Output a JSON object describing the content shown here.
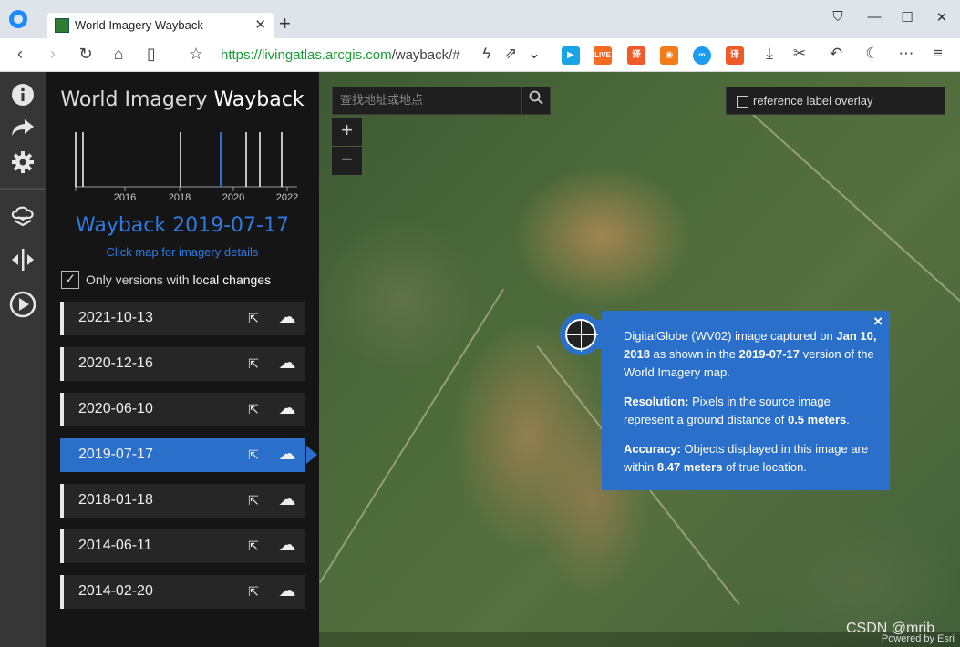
{
  "browser": {
    "tab_title": "World Imagery Wayback",
    "new_tab_symbol": "+",
    "url_host": "https://livingatlas.arcgis.com",
    "url_path": "/wayback/#",
    "window_buttons": [
      "minimize",
      "maximize",
      "close"
    ]
  },
  "app": {
    "title_light": "World Imagery",
    "title_bold": "Wayback",
    "timeline_years": [
      "2016",
      "2018",
      "2020",
      "2022"
    ],
    "selected_release": "Wayback 2019-07-17",
    "click_hint": "Click map for imagery details",
    "filter_label_prefix": "Only versions with",
    "filter_label_bold": "local changes",
    "filter_checked": true,
    "releases": [
      {
        "date": "2021-10-13",
        "active": false
      },
      {
        "date": "2020-12-16",
        "active": false
      },
      {
        "date": "2020-06-10",
        "active": false
      },
      {
        "date": "2019-07-17",
        "active": true
      },
      {
        "date": "2018-01-18",
        "active": false
      },
      {
        "date": "2014-06-11",
        "active": false
      },
      {
        "date": "2014-02-20",
        "active": false
      }
    ]
  },
  "map": {
    "search_placeholder": "查找地址或地点",
    "zoom_in": "+",
    "zoom_out": "−",
    "ref_label": "reference label overlay",
    "popup": {
      "line1_a": "DigitalGlobe (WV02) image captured on",
      "line1_date": "Jan 10, 2018",
      "line1_b": "as shown in the",
      "line1_release": "2019-07-17",
      "line1_c": "version of the World Imagery map.",
      "res_label": "Resolution:",
      "res_text_a": "Pixels in the source image represent a ground distance of",
      "res_value": "0.5 meters",
      "res_text_b": ".",
      "acc_label": "Accuracy:",
      "acc_text_a": "Objects displayed in this image are within",
      "acc_value": "8.47 meters",
      "acc_text_b": "of true location.",
      "close_symbol": "×"
    },
    "watermark": "CSDN @mrib",
    "powered_by": "Powered by Esri"
  },
  "colors": {
    "accent": "#2a6fc9",
    "panel_bg": "#151515",
    "toolbar_bg": "#363636"
  }
}
